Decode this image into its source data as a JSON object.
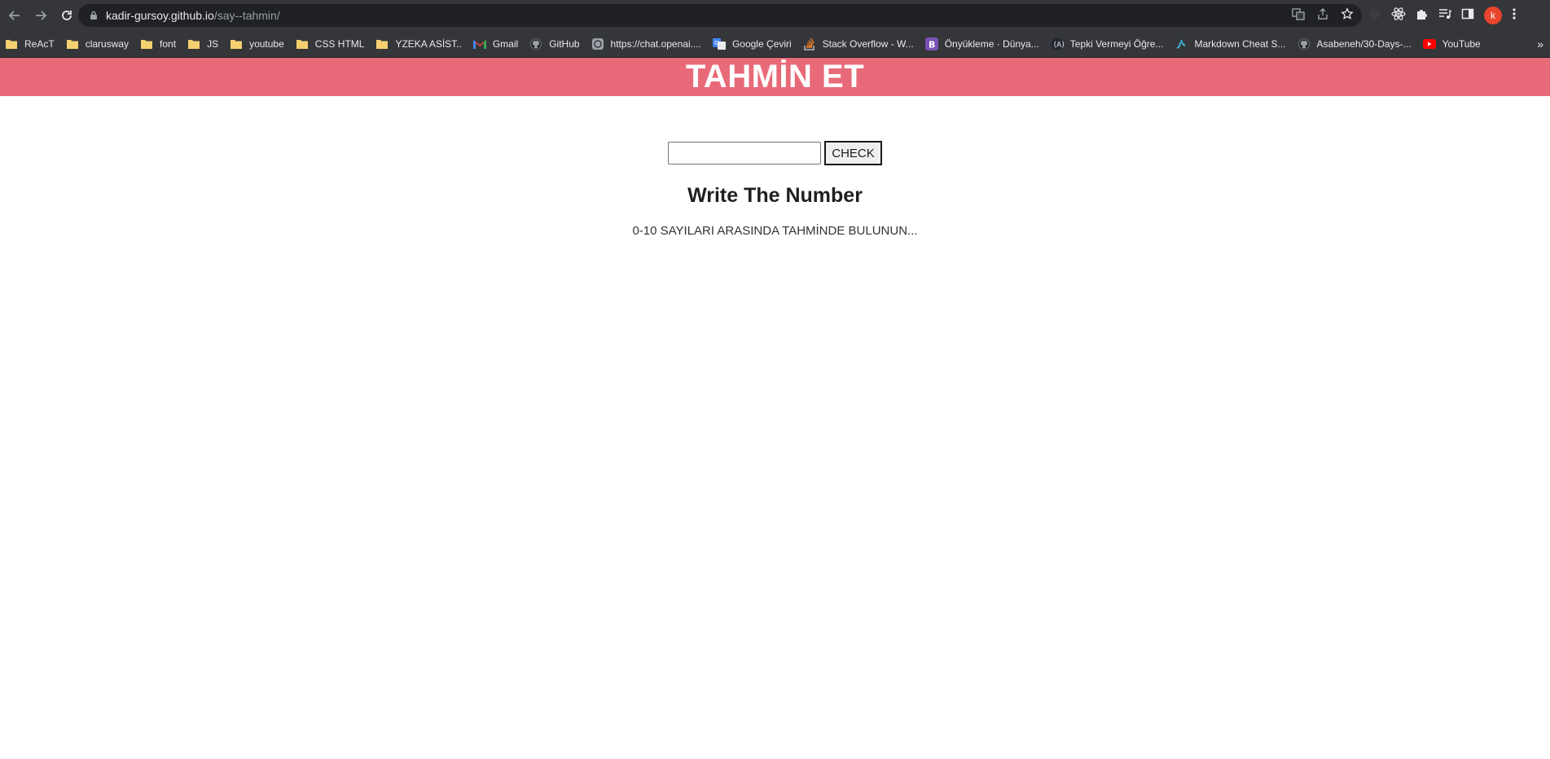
{
  "browser": {
    "url_host": "kadir-gursoy.github.io",
    "url_path": "/say--tahmin/",
    "profile_initial": "k",
    "colors": {
      "chrome": "#35363a",
      "omnibox": "#202124",
      "profile": "#e8452c"
    }
  },
  "bookmarks": [
    {
      "label": "ReAcT",
      "icon": "folder-icon"
    },
    {
      "label": "clarusway",
      "icon": "folder-icon"
    },
    {
      "label": "font",
      "icon": "folder-icon"
    },
    {
      "label": "JS",
      "icon": "folder-icon"
    },
    {
      "label": "youtube",
      "icon": "folder-icon"
    },
    {
      "label": "CSS HTML",
      "icon": "folder-icon"
    },
    {
      "label": "YZEKA ASİST..",
      "icon": "folder-icon"
    },
    {
      "label": "Gmail",
      "icon": "gmail-icon"
    },
    {
      "label": "GitHub",
      "icon": "github-icon"
    },
    {
      "label": "https://chat.openai....",
      "icon": "openai-icon"
    },
    {
      "label": "Google Çeviri",
      "icon": "translate-icon"
    },
    {
      "label": "Stack Overflow - W...",
      "icon": "stackoverflow-icon"
    },
    {
      "label": "Önyükleme · Dünya...",
      "icon": "bootstrap-icon"
    },
    {
      "label": "Tepki Vermeyi Öğre...",
      "icon": "react-icon"
    },
    {
      "label": "Markdown Cheat S...",
      "icon": "markdown-icon"
    },
    {
      "label": "Asabeneh/30-Days-...",
      "icon": "github-icon"
    },
    {
      "label": "YouTube",
      "icon": "youtube-icon"
    }
  ],
  "page": {
    "title": "TAHMİN ET",
    "input_value": "",
    "check_label": "CHECK",
    "message": "Write The Number",
    "hint": "0-10 SAYILARI ARASINDA TAHMİNDE BULUNUN...",
    "colors": {
      "header": "#e86a78"
    }
  }
}
